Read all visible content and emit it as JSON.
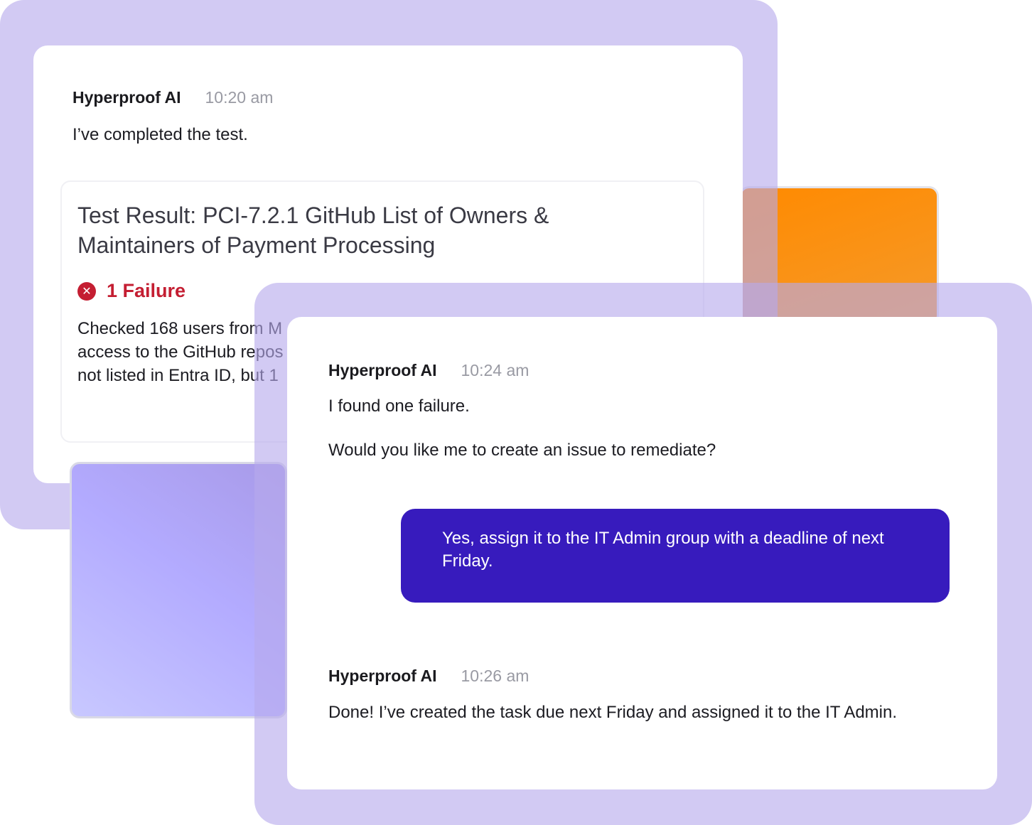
{
  "colors": {
    "frame": "#b6aaeb",
    "card": "#ffffff",
    "bubble": "#371bbd",
    "failure": "#c41e32",
    "orange_tile": "#ff8a00",
    "violet_tile": "#b3abff"
  },
  "back_chat": {
    "message": {
      "sender": "Hyperproof AI",
      "time": "10:20 am",
      "text": "I’ve completed the test."
    },
    "result": {
      "title": "Test Result: PCI-7.2.1 GitHub List of Owners & Maintainers of Payment Processing",
      "failure_icon": "x-circle-icon",
      "failure_label": "1 Failure",
      "body_lines": [
        "Checked 168 users from M",
        "access to the GitHub repos",
        "not listed in Entra ID, but 1"
      ]
    }
  },
  "front_chat": {
    "first_message": {
      "sender": "Hyperproof AI",
      "time": "10:24 am",
      "line1": "I found one failure.",
      "line2": "Would you like me to create an issue to remediate?"
    },
    "user_reply": {
      "text": "Yes, assign it to the IT Admin group with a deadline of next Friday."
    },
    "second_message": {
      "sender": "Hyperproof AI",
      "time": "10:26 am",
      "text": "Done! I’ve created the task due next Friday and assigned it to the IT Admin."
    }
  }
}
